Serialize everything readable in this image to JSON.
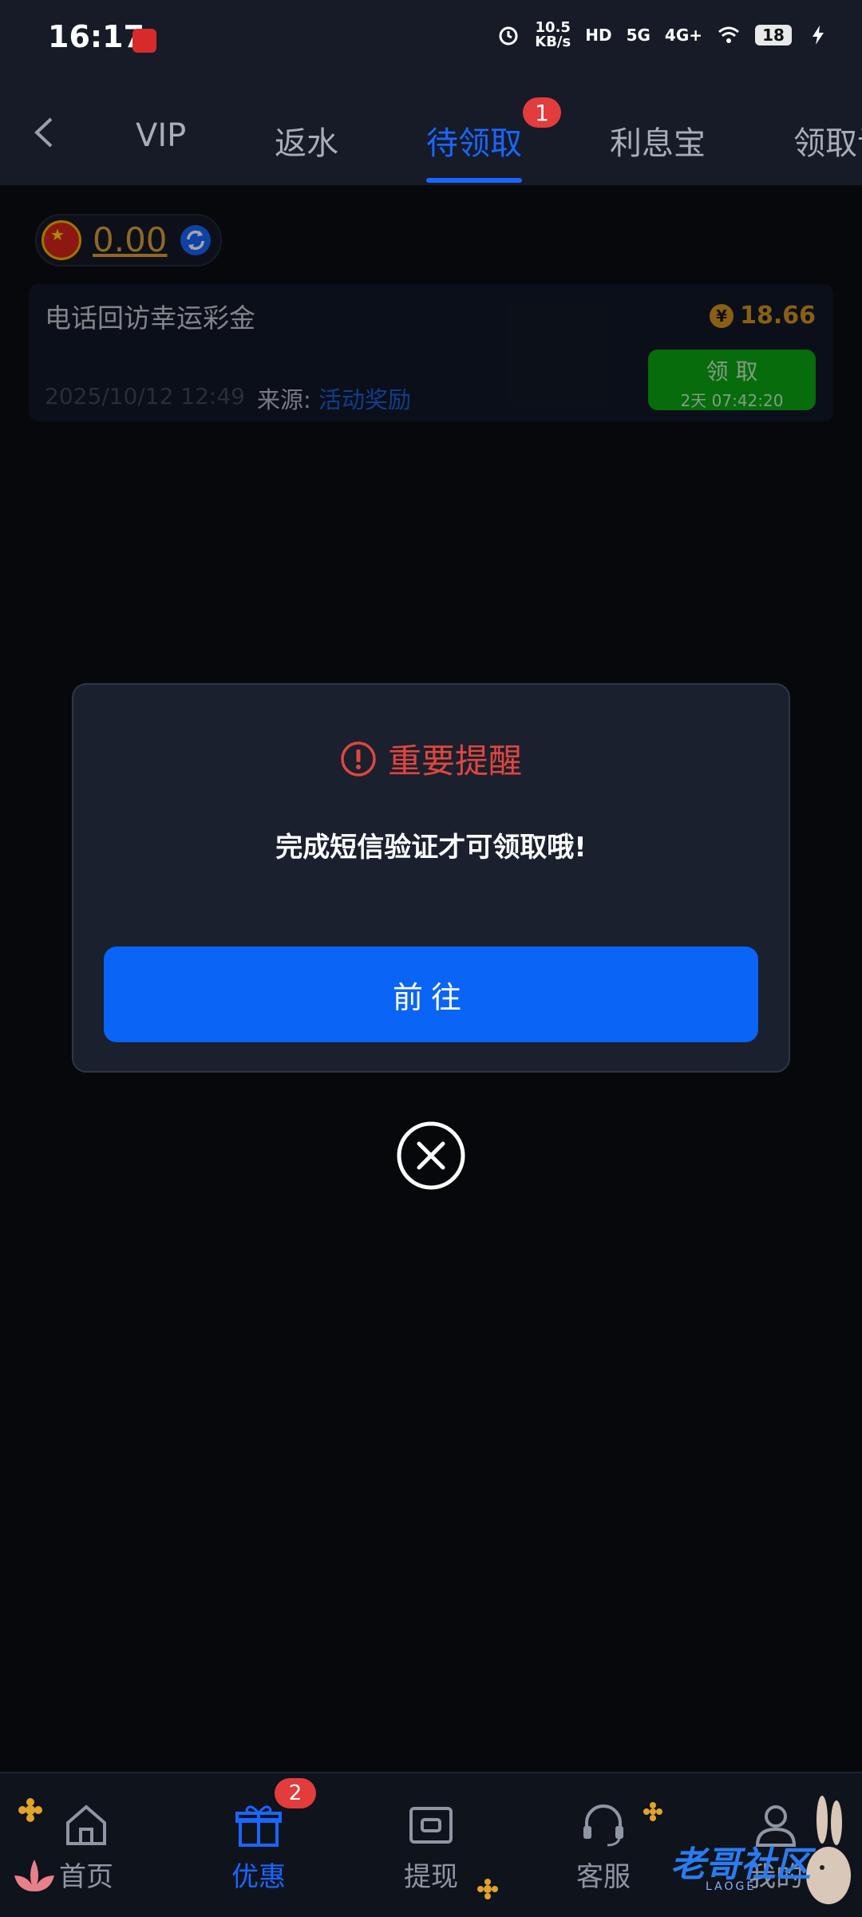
{
  "status_bar": {
    "time": "16:17",
    "net_speed_top": "10.5",
    "net_speed_bottom": "KB/s",
    "hd": "HD",
    "signal_5g": "5G",
    "signal_4g": "4G+",
    "battery": "18"
  },
  "tabs": {
    "items": [
      {
        "label": "VIP"
      },
      {
        "label": "返水"
      },
      {
        "label": "待领取"
      },
      {
        "label": "利息宝"
      },
      {
        "label": "领取记"
      }
    ],
    "active_badge": "1"
  },
  "balance": {
    "value": "0.00"
  },
  "reward_card": {
    "title": "电话回访幸运彩金",
    "currency_symbol": "¥",
    "amount": "18.66",
    "date": "2025/10/12 12:49",
    "source_label": "来源:",
    "source_value": "活动奖励",
    "claim_label": "领 取",
    "claim_countdown": "2天 07:42:20"
  },
  "modal": {
    "title": "重要提醒",
    "message": "完成短信验证才可领取哦!",
    "button_label": "前往"
  },
  "bottom_nav": {
    "items": [
      {
        "label": "首页"
      },
      {
        "label": "优惠"
      },
      {
        "label": "提现"
      },
      {
        "label": "客服"
      },
      {
        "label": "我的"
      }
    ],
    "promo_badge": "2"
  },
  "watermark": {
    "text": "老哥社区",
    "sub": "LAOGE"
  },
  "colors": {
    "accent": "#1a66ff",
    "alert": "#e0463f",
    "claim_green": "#0aa713",
    "gold": "#d8a13b"
  }
}
